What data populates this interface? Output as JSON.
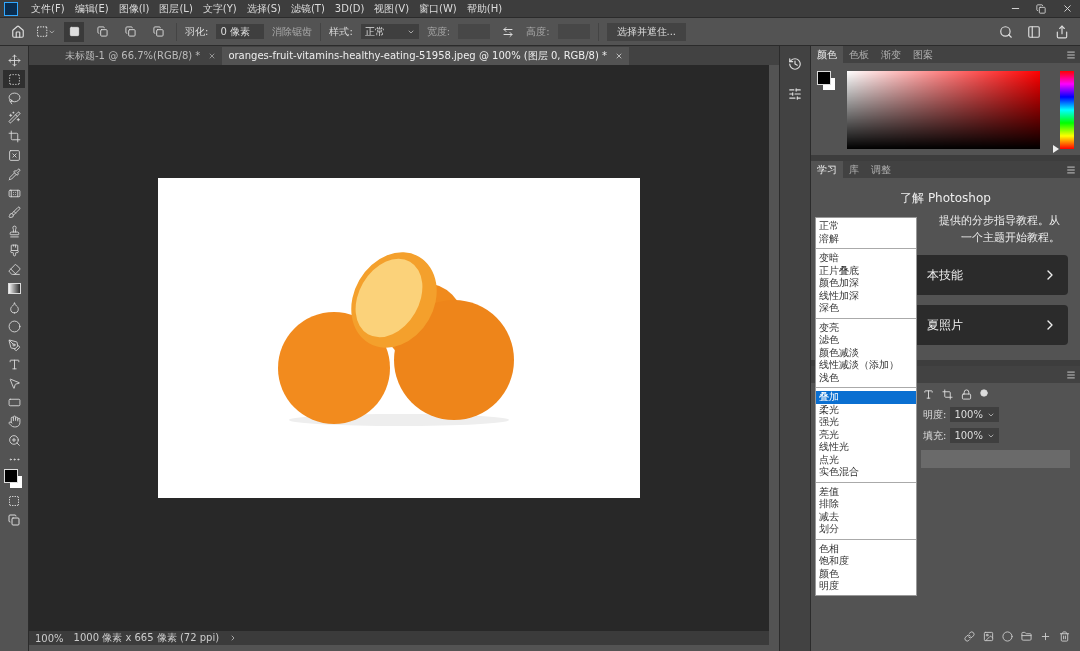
{
  "menu_bar": {
    "items": [
      "文件(F)",
      "编辑(E)",
      "图像(I)",
      "图层(L)",
      "文字(Y)",
      "选择(S)",
      "滤镜(T)",
      "3D(D)",
      "视图(V)",
      "窗口(W)",
      "帮助(H)"
    ]
  },
  "options_bar": {
    "feather_label": "羽化:",
    "feather_value": "0 像素",
    "antialias": {
      "label": "消除锯齿",
      "disabled": true
    },
    "style_label": "样式:",
    "style_value": "正常",
    "width": {
      "label": "宽度:",
      "disabled": true
    },
    "height": {
      "label": "高度:",
      "disabled": true
    },
    "select_mask_button": "选择并遮住..."
  },
  "document_tabs": [
    {
      "label": "未标题-1 @ 66.7%(RGB/8) *",
      "selected": false
    },
    {
      "label": "oranges-fruit-vitamins-healthy-eating-51958.jpeg @ 100% (图层 0, RGB/8) *",
      "selected": true
    }
  ],
  "tools": [
    {
      "kind": "move",
      "selected": false
    },
    {
      "kind": "marquee",
      "selected": true
    },
    {
      "kind": "lasso",
      "selected": false
    },
    {
      "kind": "quick-select",
      "selected": false
    },
    {
      "kind": "crop",
      "selected": false
    },
    {
      "kind": "frame",
      "selected": false
    },
    {
      "kind": "eyedropper",
      "selected": false
    },
    {
      "kind": "healing",
      "selected": false
    },
    {
      "kind": "brush",
      "selected": false
    },
    {
      "kind": "stamp",
      "selected": false
    },
    {
      "kind": "history-brush",
      "selected": false
    },
    {
      "kind": "eraser",
      "selected": false
    },
    {
      "kind": "gradient",
      "selected": false
    },
    {
      "kind": "blur",
      "selected": false
    },
    {
      "kind": "dodge",
      "selected": false
    },
    {
      "kind": "pen",
      "selected": false
    },
    {
      "kind": "type",
      "selected": false
    },
    {
      "kind": "path-select",
      "selected": false
    },
    {
      "kind": "shape",
      "selected": false
    },
    {
      "kind": "hand",
      "selected": false
    },
    {
      "kind": "zoom",
      "selected": false
    },
    {
      "kind": "more",
      "selected": false
    }
  ],
  "status_bar": {
    "zoom": "100%",
    "info": "1000 像素 x 665 像素 (72 ppi)"
  },
  "color_panel": {
    "hue_slider": {
      "level": 0
    },
    "tabs": [
      {
        "label": "颜色",
        "selected": true
      },
      {
        "label": "色板",
        "selected": false
      },
      {
        "label": "渐变",
        "selected": false
      },
      {
        "label": "图案",
        "selected": false
      }
    ]
  },
  "learn_panel": {
    "tabs": [
      {
        "label": "学习",
        "selected": true
      },
      {
        "label": "库",
        "selected": false
      },
      {
        "label": "调整",
        "selected": false
      }
    ],
    "title": "了解 Photoshop",
    "text_lines": [
      "提供的分步指导教程。从",
      "一个主题开始教程。"
    ],
    "cards": [
      "本技能",
      "夏照片"
    ]
  },
  "layers_panel": {
    "opacity_label": "明度:",
    "opacity_value": "100%",
    "fill_label": "填充:",
    "fill_value": "100%"
  },
  "blend_menu": {
    "groups": [
      {
        "items": [
          {
            "label": "正常",
            "selected": false
          },
          {
            "label": "溶解",
            "selected": false
          }
        ]
      },
      {
        "items": [
          {
            "label": "变暗",
            "selected": false
          },
          {
            "label": "正片叠底",
            "selected": false
          },
          {
            "label": "颜色加深",
            "selected": false
          },
          {
            "label": "线性加深",
            "selected": false
          },
          {
            "label": "深色",
            "selected": false
          }
        ]
      },
      {
        "items": [
          {
            "label": "变亮",
            "selected": false
          },
          {
            "label": "滤色",
            "selected": false
          },
          {
            "label": "颜色减淡",
            "selected": false
          },
          {
            "label": "线性减淡（添加）",
            "selected": false
          },
          {
            "label": "浅色",
            "selected": false
          }
        ]
      },
      {
        "items": [
          {
            "label": "叠加",
            "selected": true
          },
          {
            "label": "柔光",
            "selected": false
          },
          {
            "label": "强光",
            "selected": false
          },
          {
            "label": "亮光",
            "selected": false
          },
          {
            "label": "线性光",
            "selected": false
          },
          {
            "label": "点光",
            "selected": false
          },
          {
            "label": "实色混合",
            "selected": false
          }
        ]
      },
      {
        "items": [
          {
            "label": "差值",
            "selected": false
          },
          {
            "label": "排除",
            "selected": false
          },
          {
            "label": "减去",
            "selected": false
          },
          {
            "label": "划分",
            "selected": false
          }
        ]
      },
      {
        "items": [
          {
            "label": "色相",
            "selected": false
          },
          {
            "label": "饱和度",
            "selected": false
          },
          {
            "label": "颜色",
            "selected": false
          },
          {
            "label": "明度",
            "selected": false
          }
        ]
      }
    ]
  }
}
